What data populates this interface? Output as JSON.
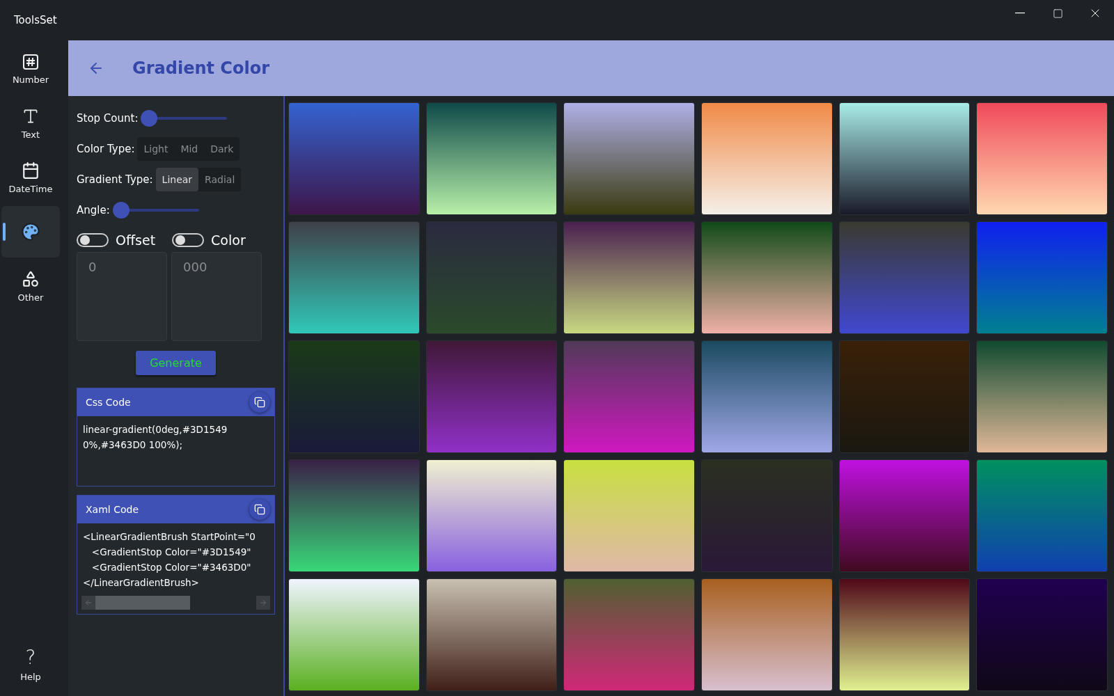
{
  "window": {
    "title": "ToolsSet"
  },
  "nav": {
    "items": [
      {
        "kind": "number",
        "label": "Number",
        "selected": false
      },
      {
        "kind": "text",
        "label": "Text",
        "selected": false
      },
      {
        "kind": "datetime",
        "label": "DateTime",
        "selected": false
      },
      {
        "kind": "palette",
        "selected": true
      },
      {
        "kind": "other",
        "label": "Other",
        "selected": false
      }
    ],
    "help": {
      "glyph": "?",
      "label": "Help"
    }
  },
  "header": {
    "title": "Gradient Color"
  },
  "controls": {
    "stop_count": {
      "label": "Stop Count:",
      "level": 0.0
    },
    "color_type": {
      "label": "Color Type:",
      "options": [
        {
          "label": "Light",
          "selected": false
        },
        {
          "label": "Mid",
          "selected": false
        },
        {
          "label": "Dark",
          "selected": false
        }
      ]
    },
    "gradient_type": {
      "label": "Gradient Type:",
      "options": [
        {
          "label": "Linear",
          "selected": true
        },
        {
          "label": "Radial",
          "selected": false
        }
      ]
    },
    "angle": {
      "label": "Angle:",
      "level": 0.0
    },
    "toggles": [
      {
        "label": "Offset",
        "on": false
      },
      {
        "label": "Color",
        "on": false
      }
    ],
    "fields": [
      {
        "placeholder": "0"
      },
      {
        "placeholder": "000"
      }
    ],
    "generate": "Generate"
  },
  "css_code": {
    "title": "Css Code",
    "lines": [
      "linear-gradient(0deg,#3D1549",
      "0%,#3463D0 100%);"
    ]
  },
  "xaml_code": {
    "title": "Xaml Code",
    "lines": [
      "<LinearGradientBrush StartPoint=\"0",
      "   <GradientStop Color=\"#3D1549\"",
      "   <GradientStop Color=\"#3463D0\"",
      "</LinearGradientBrush>"
    ]
  },
  "tiles": [
    {
      "stops": [
        {
          "color": "#3463d0"
        },
        {
          "color": "#3d1549"
        }
      ]
    },
    {
      "stops": [
        {
          "color": "#0f4a4a"
        },
        {
          "color": "#b8f0a8"
        }
      ]
    },
    {
      "stops": [
        {
          "color": "#b0b0e8"
        },
        {
          "color": "#3a3a10"
        }
      ]
    },
    {
      "stops": [
        {
          "color": "#f08a48"
        },
        {
          "color": "#f5f0e8"
        }
      ]
    },
    {
      "stops": [
        {
          "color": "#a8ece8"
        },
        {
          "color": "#1a1a2a"
        }
      ]
    },
    {
      "stops": [
        {
          "color": "#f04a5a"
        },
        {
          "color": "#ffd8b0"
        }
      ]
    },
    {
      "stops": [
        {
          "color": "#404048"
        },
        {
          "color": "#30c8b8"
        }
      ]
    },
    {
      "stops": [
        {
          "color": "#2a2a40"
        },
        {
          "color": "#2a4a2a"
        }
      ]
    },
    {
      "stops": [
        {
          "color": "#4a2050"
        },
        {
          "color": "#c8d880"
        }
      ]
    },
    {
      "stops": [
        {
          "color": "#104a18"
        },
        {
          "color": "#f0b0a8"
        }
      ]
    },
    {
      "stops": [
        {
          "color": "#3a3a30"
        },
        {
          "color": "#4048d0"
        }
      ]
    },
    {
      "stops": [
        {
          "color": "#1020f0"
        },
        {
          "color": "#008090"
        }
      ]
    },
    {
      "stops": [
        {
          "color": "#1a3a18"
        },
        {
          "color": "#1a1a3a"
        }
      ]
    },
    {
      "stops": [
        {
          "color": "#401838"
        },
        {
          "color": "#9030c8"
        }
      ]
    },
    {
      "stops": [
        {
          "color": "#503a58"
        },
        {
          "color": "#d018c0"
        }
      ]
    },
    {
      "stops": [
        {
          "color": "#1a4a60"
        },
        {
          "color": "#a0a8e8"
        }
      ]
    },
    {
      "stops": [
        {
          "color": "#3a2008"
        },
        {
          "color": "#1a1810"
        }
      ]
    },
    {
      "stops": [
        {
          "color": "#104a30"
        },
        {
          "color": "#e0b898"
        }
      ]
    },
    {
      "stops": [
        {
          "color": "#3a2048"
        },
        {
          "color": "#38d878"
        }
      ]
    },
    {
      "stops": [
        {
          "color": "#f0f0d0"
        },
        {
          "color": "#8860e0"
        }
      ]
    },
    {
      "stops": [
        {
          "color": "#c8e040"
        },
        {
          "color": "#e0b8a8"
        }
      ]
    },
    {
      "stops": [
        {
          "color": "#2a3020"
        },
        {
          "color": "#2a1838"
        }
      ]
    },
    {
      "stops": [
        {
          "color": "#c010e0"
        },
        {
          "color": "#400a20"
        }
      ]
    },
    {
      "stops": [
        {
          "color": "#009060"
        },
        {
          "color": "#1040b0"
        }
      ]
    },
    {
      "stops": [
        {
          "color": "#f0f4ff"
        },
        {
          "color": "#5ab020"
        }
      ]
    },
    {
      "stops": [
        {
          "color": "#c8c0b0"
        },
        {
          "color": "#402018"
        }
      ]
    },
    {
      "stops": [
        {
          "color": "#506030"
        },
        {
          "color": "#d02878"
        }
      ]
    },
    {
      "stops": [
        {
          "color": "#a86020"
        },
        {
          "color": "#d8c0d0"
        }
      ]
    },
    {
      "stops": [
        {
          "color": "#500818"
        },
        {
          "color": "#e0f090"
        }
      ]
    },
    {
      "stops": [
        {
          "color": "#200050"
        },
        {
          "color": "#100818"
        }
      ]
    }
  ]
}
